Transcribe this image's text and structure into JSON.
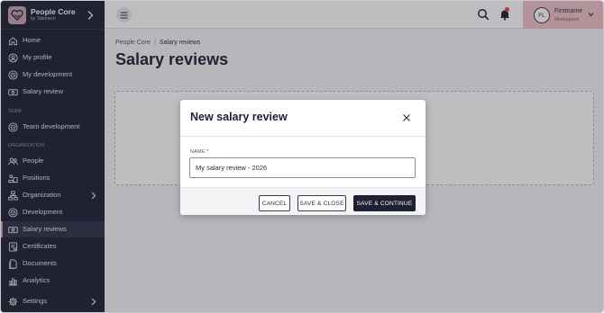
{
  "brand": {
    "title": "People Core",
    "subtitle": "by Talentech"
  },
  "sidebar": {
    "items": [
      {
        "label": "Home",
        "icon": "home-icon"
      },
      {
        "label": "My profile",
        "icon": "user-circle-icon"
      },
      {
        "label": "My development",
        "icon": "target-icon"
      },
      {
        "label": "Salary review",
        "icon": "money-icon"
      }
    ],
    "team_section": "TEAM",
    "team_items": [
      {
        "label": "Team development",
        "icon": "target-icon"
      }
    ],
    "org_section": "ORGANIZATION",
    "org_items": [
      {
        "label": "People",
        "icon": "people-icon"
      },
      {
        "label": "Positions",
        "icon": "positions-icon"
      },
      {
        "label": "Organization",
        "icon": "organization-icon"
      },
      {
        "label": "Development",
        "icon": "target-icon"
      },
      {
        "label": "Salary reviews",
        "icon": "money-icon",
        "active": true
      },
      {
        "label": "Certificates",
        "icon": "certificate-icon"
      },
      {
        "label": "Documents",
        "icon": "documents-icon"
      },
      {
        "label": "Analytics",
        "icon": "analytics-icon"
      }
    ],
    "settings": {
      "label": "Settings",
      "icon": "gear-icon"
    }
  },
  "topbar": {
    "user": {
      "initials": "FL",
      "name": "Firstname",
      "workspace": "Workspace"
    }
  },
  "page": {
    "breadcrumb": {
      "root": "People Core",
      "separator": "/",
      "current": "Salary reviews"
    },
    "title": "Salary reviews"
  },
  "modal": {
    "title": "New salary review",
    "field_label": "NAME *",
    "field_value": "My salary review - 2026",
    "cancel_label": "CANCEL",
    "save_close_label": "SAVE & CLOSE",
    "save_continue_label": "SAVE & CONTINUE"
  },
  "colors": {
    "sidebar": "#1e2033",
    "accent": "#d4a1a9",
    "user_area": "#efc2c6",
    "primary_button": "#1e2033"
  }
}
